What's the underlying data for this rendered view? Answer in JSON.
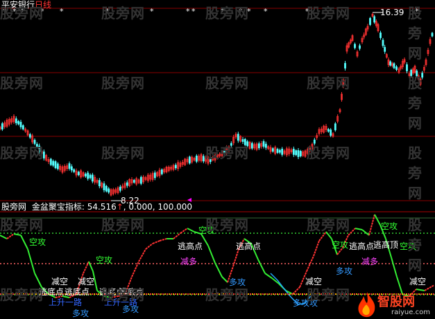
{
  "header": {
    "stock_name": "平安银行",
    "period": "日线"
  },
  "main_panel": {
    "high_label": "16.39",
    "low_label": "8.22",
    "star_glyph": "*"
  },
  "indicator_panel": {
    "source": "股旁网",
    "name": "金盆聚宝指标:",
    "value": "54.516",
    "arrow": "↑",
    "v2": "0.000",
    "v3": "100.000"
  },
  "signals": {
    "attack_empty": "空攻",
    "reduce_empty": "减空",
    "escape_bottom": "逃底点",
    "escape_top": "逃高点",
    "long_attack": "多攻",
    "reduce_long": "减多",
    "escape_top2": "逃高顶",
    "up_one": "上升一路",
    "long_ward": "多攻攻"
  },
  "watermark": {
    "text": "股旁网",
    "logo_text": "智股网",
    "logo_url": "raiyue.com"
  },
  "colors": {
    "background": "#000000",
    "up_candle": "#ff3232",
    "down_candle": "#54ffff",
    "grid_red": "#8b0000",
    "line_green": "#33cc33",
    "accent_magenta": "#ff00ff"
  }
}
